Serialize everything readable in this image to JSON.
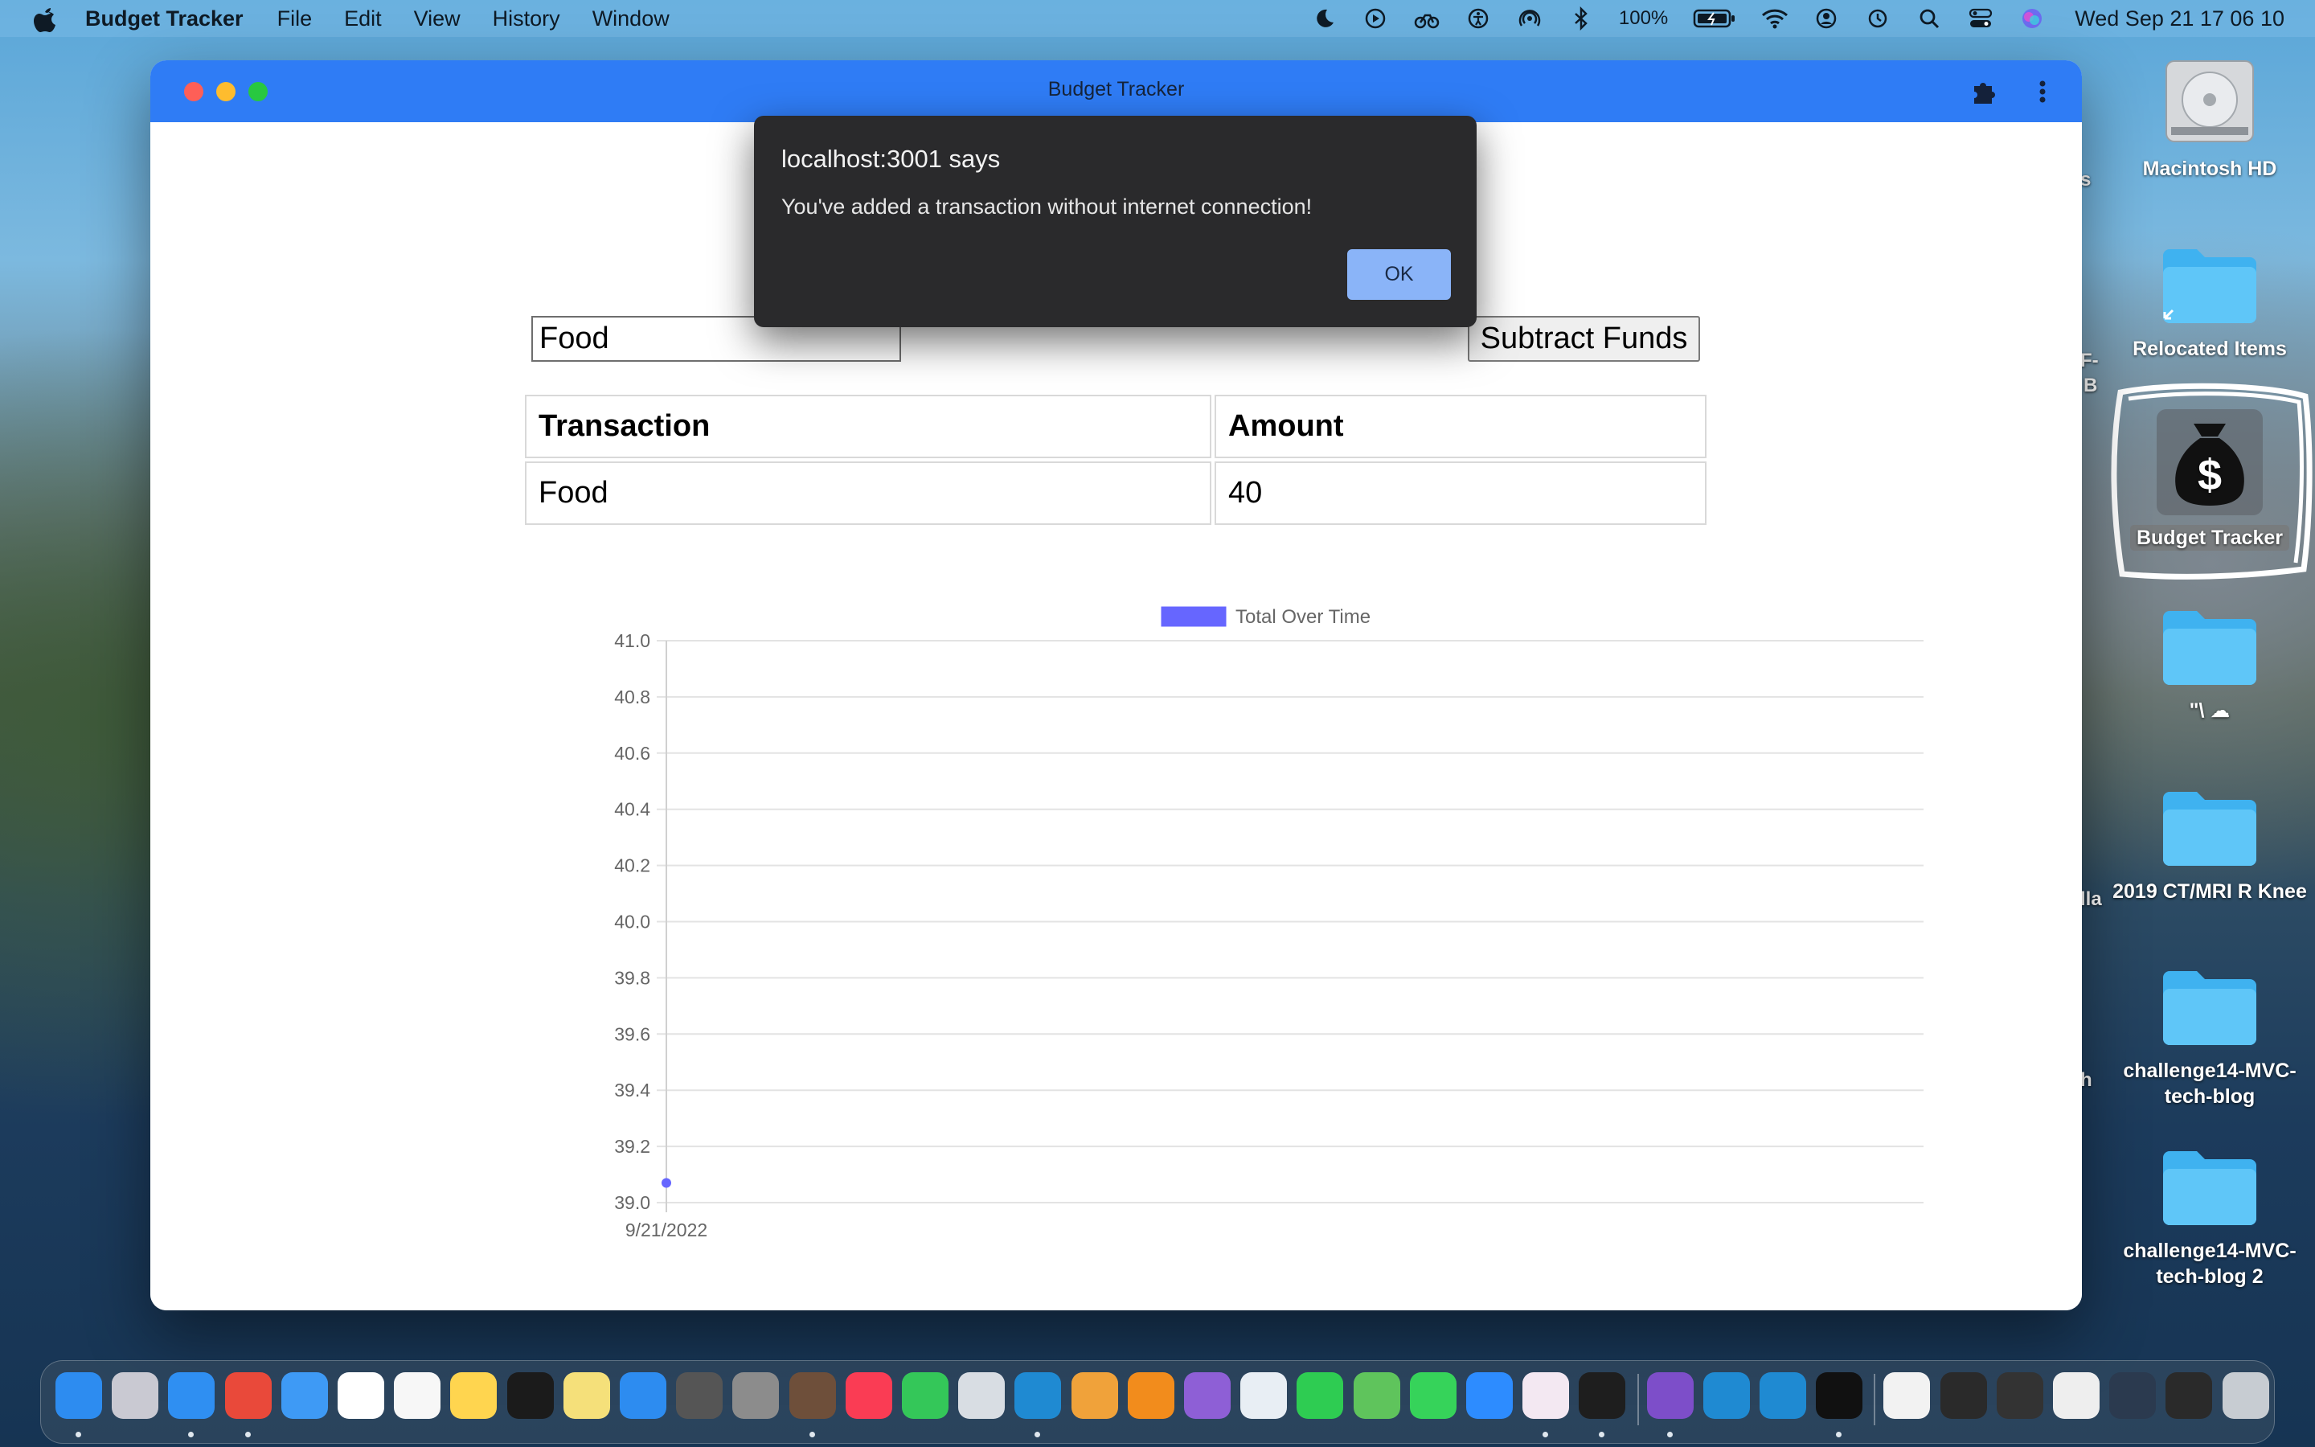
{
  "menubar": {
    "app_name": "Budget Tracker",
    "menus": [
      "File",
      "Edit",
      "View",
      "History",
      "Window"
    ],
    "battery": "100%",
    "clock": "Wed Sep 21  17 06 10"
  },
  "window": {
    "title": "Budget Tracker",
    "form": {
      "name_value": "Food",
      "subtract_label": "Subtract Funds"
    },
    "table": {
      "headers": [
        "Transaction",
        "Amount"
      ],
      "rows": [
        [
          "Food",
          "40"
        ]
      ]
    }
  },
  "chart_data": {
    "type": "line",
    "x": [
      "9/21/2022"
    ],
    "series": [
      {
        "name": "Total Over Time",
        "values": [
          39.07
        ],
        "color": "#6666ff"
      }
    ],
    "yticks": [
      "41.0",
      "40.8",
      "40.6",
      "40.4",
      "40.2",
      "40.0",
      "39.8",
      "39.6",
      "39.4",
      "39.2",
      "39.0"
    ],
    "ylim": [
      39.0,
      41.0
    ],
    "legend": "top",
    "grid": true
  },
  "alert": {
    "title": "localhost:3001 says",
    "message": "You've added a transaction without internet connection!",
    "ok_label": "OK"
  },
  "desktop": {
    "items": [
      {
        "name": "drive",
        "label": "Macintosh HD"
      },
      {
        "name": "folder",
        "label": "Relocated Items"
      },
      {
        "name": "app",
        "label": "Budget Tracker"
      },
      {
        "name": "folder",
        "label": "\"\\ ☁"
      },
      {
        "name": "folder",
        "label": "2019 CT/MRI R Knee"
      },
      {
        "name": "folder",
        "label": "challenge14-MVC-tech-blog"
      },
      {
        "name": "folder",
        "label": "challenge14-MVC-tech-blog 2"
      }
    ],
    "edge_labels": [
      "s",
      "F-",
      "B",
      "lla",
      "h"
    ]
  },
  "dock": {
    "apps": [
      {
        "name": "finder",
        "color": "#2d8cf0",
        "running": true
      },
      {
        "name": "launchpad",
        "color": "#c9c9d2",
        "running": false
      },
      {
        "name": "safari",
        "color": "#2f8ff2",
        "running": true
      },
      {
        "name": "chrome",
        "color": "#e9493a",
        "running": true
      },
      {
        "name": "mail",
        "color": "#3e9af5",
        "running": false
      },
      {
        "name": "calendar",
        "color": "#ffffff",
        "running": false
      },
      {
        "name": "reminders",
        "color": "#f7f7f7",
        "running": false
      },
      {
        "name": "notes",
        "color": "#ffd54f",
        "running": false
      },
      {
        "name": "tv",
        "color": "#1b1b1b",
        "running": false
      },
      {
        "name": "stickies",
        "color": "#f5e07a",
        "running": false
      },
      {
        "name": "app-store",
        "color": "#2d8cf0",
        "running": false
      },
      {
        "name": "calculator",
        "color": "#555555",
        "running": false
      },
      {
        "name": "system-preferences",
        "color": "#8c8c8c",
        "running": false
      },
      {
        "name": "preview",
        "color": "#6e4f3a",
        "running": true
      },
      {
        "name": "music",
        "color": "#fa3c54",
        "running": false
      },
      {
        "name": "find-my",
        "color": "#34c759",
        "running": false
      },
      {
        "name": "photos-viewer",
        "color": "#d8dde3",
        "running": false
      },
      {
        "name": "vscode",
        "color": "#1f8ad2",
        "running": true
      },
      {
        "name": "photos",
        "color": "#f0a23a",
        "running": false
      },
      {
        "name": "vlc",
        "color": "#f28c1c",
        "running": false
      },
      {
        "name": "affinity",
        "color": "#8e5fd6",
        "running": false
      },
      {
        "name": "printer",
        "color": "#e8eef4",
        "running": false
      },
      {
        "name": "facetime",
        "color": "#2ecc52",
        "running": false
      },
      {
        "name": "maps",
        "color": "#5fc45c",
        "running": false
      },
      {
        "name": "messages",
        "color": "#36d35a",
        "running": false
      },
      {
        "name": "zoom",
        "color": "#2d8cff",
        "running": false
      },
      {
        "name": "slack",
        "color": "#f3e8f2",
        "running": true
      },
      {
        "name": "terminal",
        "color": "#1e1e1e",
        "running": true
      },
      {
        "name": "tor",
        "color": "#7d4ec9",
        "running": true
      },
      {
        "name": "vscode-2",
        "color": "#1f8ad2",
        "running": false
      },
      {
        "name": "vscode-3",
        "color": "#1f8ad2",
        "running": false
      },
      {
        "name": "budget-tracker",
        "color": "#111111",
        "running": true
      },
      {
        "name": "doc-1",
        "color": "#f2f2f2",
        "running": false
      },
      {
        "name": "doc-2",
        "color": "#2a2a2a",
        "running": false
      },
      {
        "name": "doc-3",
        "color": "#333333",
        "running": false
      },
      {
        "name": "doc-4",
        "color": "#eeeeee",
        "running": false
      },
      {
        "name": "doc-5",
        "color": "#2b3a4f",
        "running": false
      },
      {
        "name": "doc-6",
        "color": "#2a2a2a",
        "running": false
      },
      {
        "name": "trash",
        "color": "#c7ccd2",
        "running": false
      }
    ]
  }
}
